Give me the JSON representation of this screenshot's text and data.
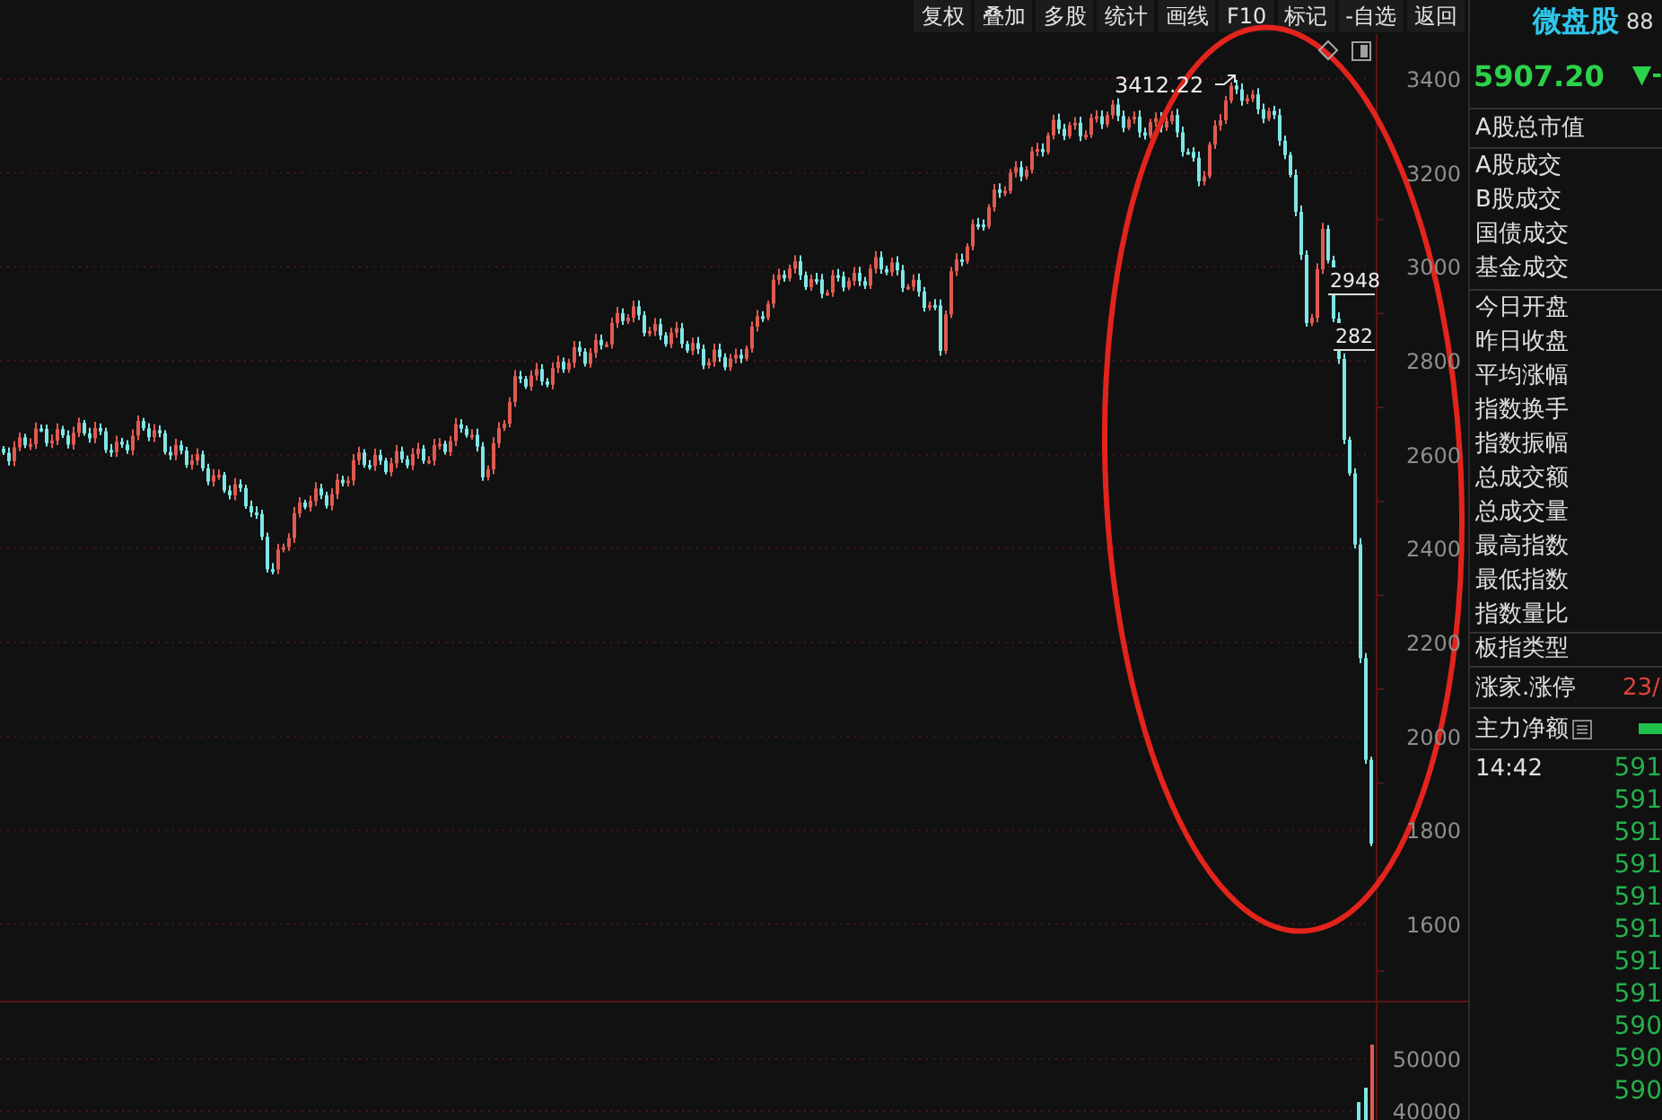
{
  "toolbar": {
    "buttons": [
      "复权",
      "叠加",
      "多股",
      "统计",
      "画线",
      "F10",
      "标记",
      "-自选",
      "返回"
    ]
  },
  "chart": {
    "high_label": "3412.22",
    "price_tags": [
      "2948",
      "282"
    ],
    "price_ticks": [
      "3400",
      "3200",
      "3000",
      "2800",
      "2600",
      "2400",
      "2200",
      "2000",
      "1800",
      "1600"
    ],
    "volume_ticks": [
      "50000",
      "40000"
    ]
  },
  "quote": {
    "name": "微盘股",
    "code": "88",
    "price": "5907.20",
    "change": "▼-"
  },
  "stats": [
    [
      "A股总市值"
    ],
    [
      "A股成交",
      "B股成交",
      "国债成交",
      "基金成交"
    ],
    [
      "今日开盘",
      "昨日收盘",
      "平均涨幅",
      "指数换手",
      "指数振幅",
      "总成交额",
      "总成交量",
      "最高指数",
      "最低指数",
      "指数量比"
    ],
    [
      "板指类型"
    ]
  ],
  "breadth": {
    "label": "涨家.涨停",
    "value": "23/"
  },
  "net_flow": {
    "label": "主力净额"
  },
  "ticks": [
    {
      "time": "14:42",
      "price": "591"
    },
    {
      "price": "591"
    },
    {
      "price": "591"
    },
    {
      "price": "591"
    },
    {
      "price": "591"
    },
    {
      "price": "591"
    },
    {
      "price": "591"
    },
    {
      "price": "591"
    },
    {
      "price": "590"
    },
    {
      "price": "590"
    },
    {
      "price": "590"
    }
  ]
}
